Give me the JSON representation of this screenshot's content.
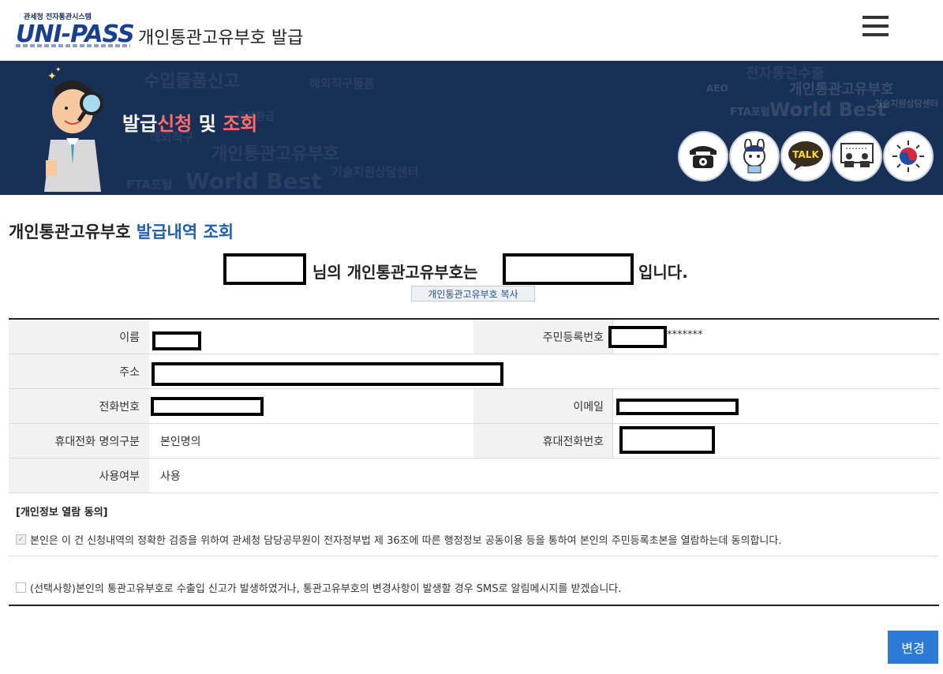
{
  "header": {
    "logo_small": "관세청 전자통관시스템",
    "logo_main": "UNI-PASS",
    "title": "개인통관고유부호 발급"
  },
  "banner": {
    "title_part1": "발급",
    "title_part2": "신청",
    "title_part3": " 및 ",
    "title_part4": "조회",
    "bg_words": [
      "수입물품신고",
      "해외직구물품",
      "전자통관수출",
      "개인통관고유부호",
      "World Best",
      "FTA포털",
      "기술지원상담센터",
      "AEO",
      "해외직구",
      "개인통관고유부호",
      "World Best",
      "FTA포털",
      "기술지원상담센터",
      "관세환급"
    ],
    "icons": [
      "telephone-icon",
      "mascot-icon",
      "kakao-talk-icon",
      "video-consult-icon",
      "government-emblem-icon"
    ],
    "talk_label": "TALK"
  },
  "section": {
    "title_black": "개인통관고유부호",
    "title_blue": "발급내역 조회"
  },
  "result": {
    "text1": "님의 개인통관고유부호는",
    "text2": "입니다.",
    "copy_button": "개인통관고유부호 복사"
  },
  "table": {
    "name_label": "이름",
    "rrn_label": "주민등록번호",
    "rrn_mask": "*******",
    "address_label": "주소",
    "phone_label": "전화번호",
    "email_label": "이메일",
    "mobile_owner_label": "휴대전화 명의구분",
    "mobile_owner_value": "본인명의",
    "mobile_label": "휴대전화번호",
    "usage_label": "사용여부",
    "usage_value": "사용"
  },
  "consent": {
    "heading": "[개인정보 열람 동의]",
    "item1": "본인은 이 건 신청내역의 정확한 검증을 위하여 관세청 담당공무원이 전자정부법 제 36조에 따른 행정정보 공동이용 등을 통하여 본인의 주민등록초본을 열람하는데 동의합니다.",
    "item1_checked": true,
    "item2": "(선택사항)본인의 통관고유부호로 수출입 신고가 발생하였거나, 통관고유부호의 변경사항이 발생할 경우 SMS로 알림메시지를 받겠습니다.",
    "item2_checked": false
  },
  "actions": {
    "change_button": "변경"
  }
}
